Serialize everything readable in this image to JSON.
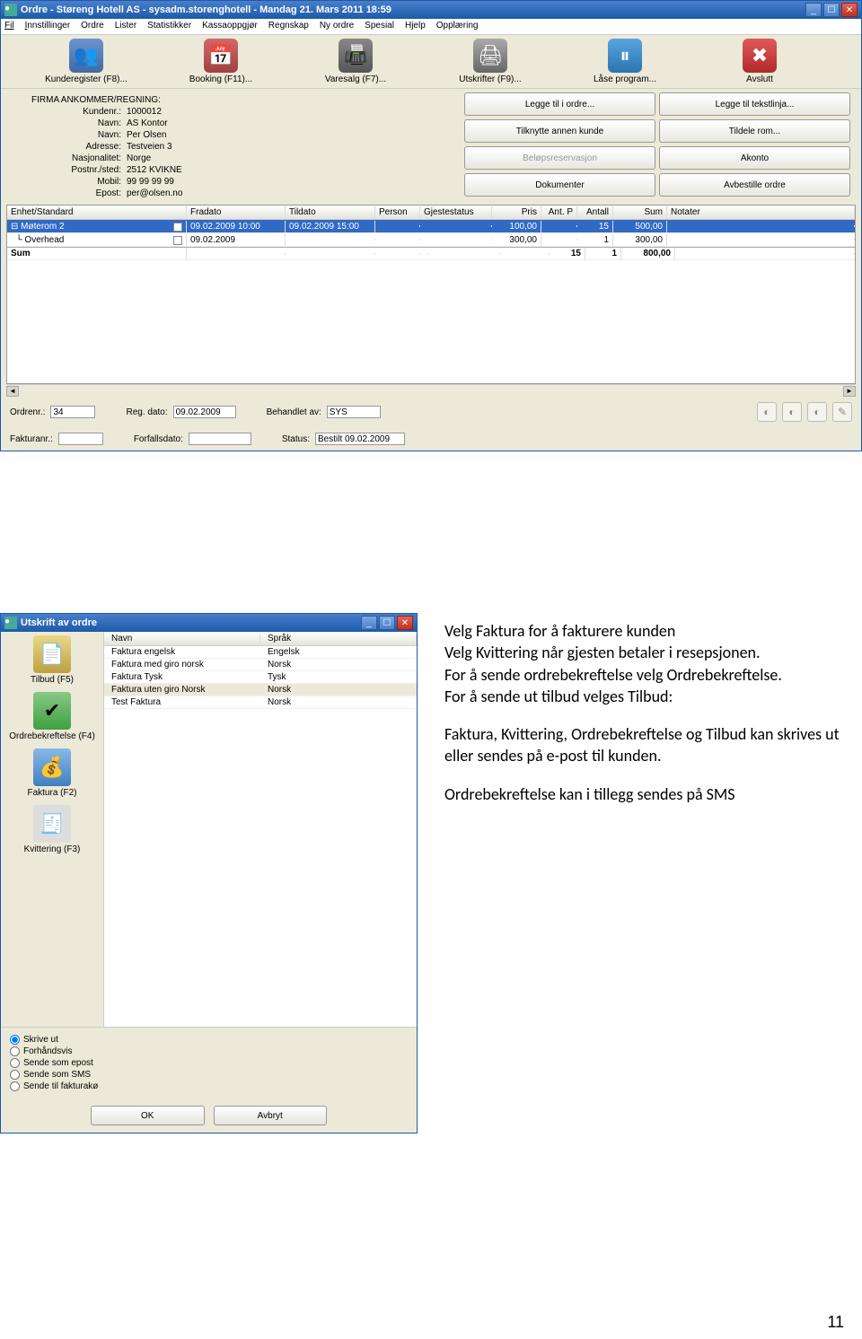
{
  "win1": {
    "title": "Ordre - Støreng Hotell AS - sysadm.storenghotell - Mandag 21. Mars 2011 18:59",
    "menu": [
      "Fil",
      "Innstillinger",
      "Ordre",
      "Lister",
      "Statistikker",
      "Kassaoppgjør",
      "Regnskap",
      "Ny ordre",
      "Spesial",
      "Hjelp",
      "Opplæring"
    ],
    "toolbar": [
      {
        "icon": "users",
        "label": "Kunderegister (F8)..."
      },
      {
        "icon": "cal",
        "label": "Booking (F11)..."
      },
      {
        "icon": "fax",
        "label": "Varesalg (F7)..."
      },
      {
        "icon": "print",
        "label": "Utskrifter (F9)..."
      },
      {
        "icon": "pause",
        "label": "Låse program..."
      },
      {
        "icon": "close",
        "label": "Avslutt"
      }
    ],
    "info": {
      "hdr": "FIRMA   ANKOMMER/REGNING:",
      "rows": [
        [
          "Kundenr.:",
          "1000012"
        ],
        [
          "Navn:",
          "AS Kontor"
        ],
        [
          "Navn:",
          "Per Olsen"
        ],
        [
          "Adresse:",
          "Testveien 3"
        ],
        [
          "Nasjonalitet:",
          "Norge"
        ],
        [
          "Postnr./sted:",
          "2512 KVIKNE"
        ],
        [
          "Mobil:",
          "99 99 99 99"
        ],
        [
          "Epost:",
          "per@olsen.no"
        ]
      ]
    },
    "actions": [
      "Legge til i ordre...",
      "Legge til tekstlinja...",
      "Tilknytte annen kunde",
      "Tildele rom...",
      "Beløpsreservasjon",
      "Akonto",
      "Dokumenter",
      "Avbestille ordre"
    ],
    "thead": [
      "Enhet/Standard",
      "Fradato",
      "Tildato",
      "Person",
      "Gjestestatus",
      "Pris",
      "Ant. P",
      "Antall",
      "Sum",
      "Notater"
    ],
    "rows": [
      {
        "sel": true,
        "c": [
          "Møterom 2",
          "09.02.2009 10:00",
          "09.02.2009 15:00",
          "",
          "",
          "100,00",
          "",
          "15",
          "500,00",
          ""
        ]
      },
      {
        "sel": false,
        "c": [
          "Overhead",
          "09.02.2009",
          "",
          "",
          "",
          "300,00",
          "",
          "1",
          "300,00",
          ""
        ]
      }
    ],
    "sumrow": [
      "Sum",
      "",
      "",
      "",
      "",
      "",
      "15",
      "1",
      "800,00",
      ""
    ],
    "bottom": {
      "ordrenr_l": "Ordrenr.:",
      "ordrenr_v": "34",
      "regdato_l": "Reg. dato:",
      "regdato_v": "09.02.2009",
      "behav_l": "Behandlet av:",
      "behav_v": "SYS",
      "fakturanr_l": "Fakturanr.:",
      "fakturanr_v": "",
      "forfall_l": "Forfallsdato:",
      "forfall_v": "",
      "status_l": "Status:",
      "status_v": "Bestilt 09.02.2009"
    }
  },
  "win2": {
    "title": "Utskrift av ordre",
    "side": [
      {
        "icon": "tilbud",
        "label": "Tilbud (F5)"
      },
      {
        "icon": "ordre",
        "label": "Ordrebekreftelse (F4)"
      },
      {
        "icon": "faktura",
        "label": "Faktura (F2)"
      },
      {
        "icon": "kvitt",
        "label": "Kvittering (F3)"
      }
    ],
    "listhead": [
      "Navn",
      "Språk"
    ],
    "listrows": [
      [
        "Faktura engelsk",
        "Engelsk"
      ],
      [
        "Faktura med giro norsk",
        "Norsk"
      ],
      [
        "Faktura Tysk",
        "Tysk"
      ],
      [
        "Faktura uten giro Norsk",
        "Norsk"
      ],
      [
        "Test Faktura",
        "Norsk"
      ]
    ],
    "opts": [
      "Skrive ut",
      "Forhåndsvis",
      "Sende som epost",
      "Sende som SMS",
      "Sende til fakturakø"
    ],
    "ok": "OK",
    "cancel": "Avbryt"
  },
  "doc": {
    "p1": "Velg Faktura for å fakturere kunden",
    "p2": "Velg Kvittering når gjesten betaler i resepsjonen.",
    "p3": "For å sende ordrebekreftelse velg Ordrebekreftelse.",
    "p4": "For å sende ut tilbud velges Tilbud:",
    "p5": "Faktura, Kvittering, Ordrebekreftelse og Tilbud kan skrives ut eller sendes på e-post til kunden.",
    "p6": "Ordrebekreftelse kan i tillegg sendes på SMS",
    "page": "11"
  }
}
